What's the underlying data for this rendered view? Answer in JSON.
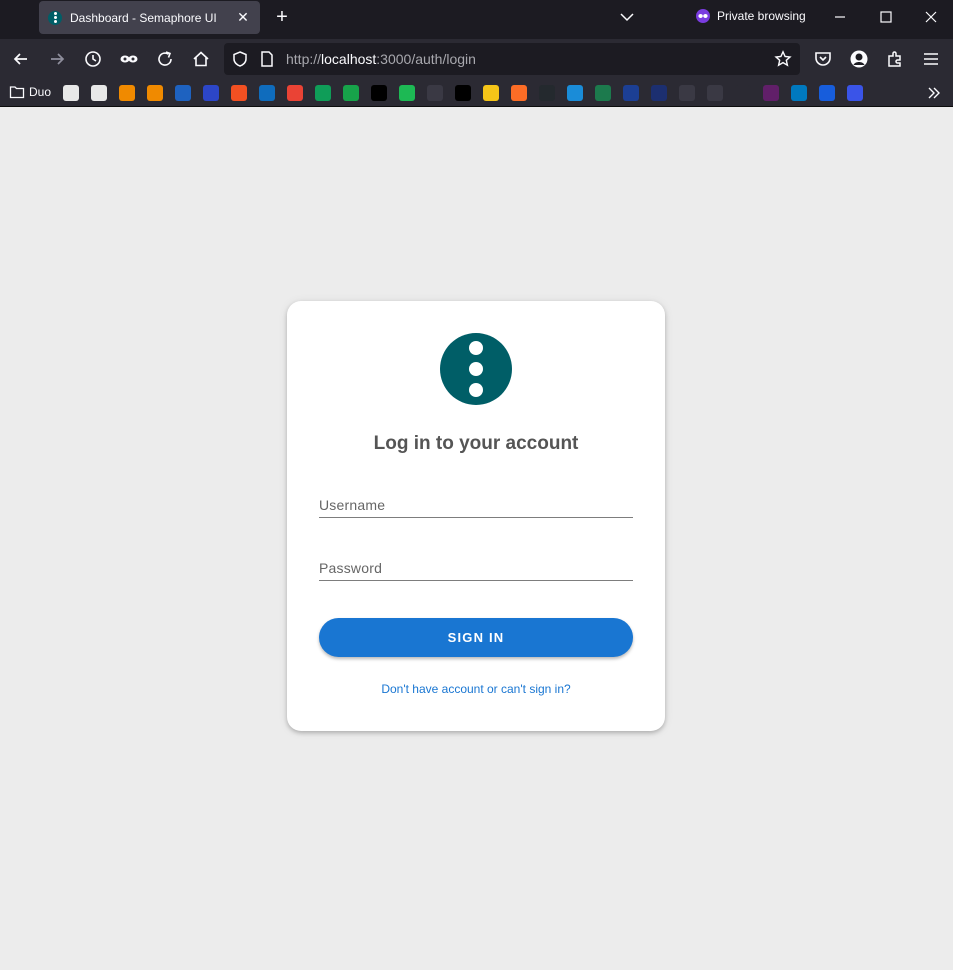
{
  "browser": {
    "tab": {
      "title": "Dashboard - Semaphore UI",
      "favicon": "semaphore-logo-icon"
    },
    "private_label": "Private browsing",
    "url": {
      "prefix": "http://",
      "host": "localhost",
      "rest": ":3000/auth/login"
    },
    "bookmarks_folder": "Duo",
    "bookmarks": [
      {
        "name": "penguin-icon",
        "color": "#e8e8e8"
      },
      {
        "name": "penguin-icon",
        "color": "#e8e8e8"
      },
      {
        "name": "infinity-icon",
        "color": "#f08a00"
      },
      {
        "name": "orange-cluster-icon",
        "color": "#f08a00"
      },
      {
        "name": "oth-icon",
        "color": "#1e62c0"
      },
      {
        "name": "location-pin-icon",
        "color": "#2c46c8"
      },
      {
        "name": "microsoft-icon",
        "color": "#f25022"
      },
      {
        "name": "outlook-icon",
        "color": "#0f6cbd"
      },
      {
        "name": "gmail-icon",
        "color": "#ea4335"
      },
      {
        "name": "green-flag-icon",
        "color": "#0f9d58"
      },
      {
        "name": "q-icon",
        "color": "#17a34a"
      },
      {
        "name": "x-icon",
        "color": "#000000"
      },
      {
        "name": "spotify-icon",
        "color": "#1db954"
      },
      {
        "name": "me-icon",
        "color": "#3a3944"
      },
      {
        "name": "dots-icon",
        "color": "#000000"
      },
      {
        "name": "tux-icon",
        "color": "#f5c518"
      },
      {
        "name": "gitlab-icon",
        "color": "#fc6d26"
      },
      {
        "name": "github-icon",
        "color": "#24292e"
      },
      {
        "name": "edge-icon",
        "color": "#1a8cd8"
      },
      {
        "name": "emblem-icon",
        "color": "#1c7a4d"
      },
      {
        "name": "o-icon",
        "color": "#1c3f94"
      },
      {
        "name": "pro-icon",
        "color": "#1c2f70"
      },
      {
        "name": "binary-icon",
        "color": "#3a3944"
      },
      {
        "name": "blank-page-icon",
        "color": "#3a3944"
      },
      {
        "name": "globe-icon",
        "color": "#2b2a33"
      },
      {
        "name": "slack-icon",
        "color": "#611f69"
      },
      {
        "name": "trello-icon",
        "color": "#0079bf"
      },
      {
        "name": "bitwarden-icon",
        "color": "#175ddc"
      },
      {
        "name": "translate-icon",
        "color": "#3a54e8"
      }
    ]
  },
  "login": {
    "title": "Log in to your account",
    "username_placeholder": "Username",
    "password_placeholder": "Password",
    "signin_label": "SIGN IN",
    "help_link": "Don't have account or can't sign in?"
  },
  "colors": {
    "brand": "#005e67",
    "primary": "#1976d2",
    "page_background": "#ececec"
  }
}
